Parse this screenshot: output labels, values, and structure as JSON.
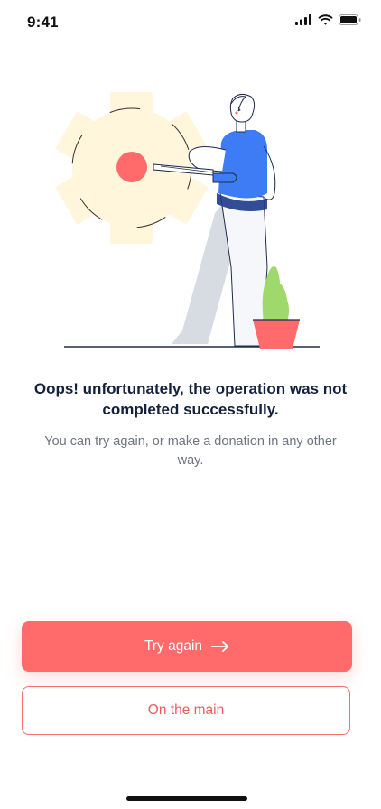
{
  "status_bar": {
    "time": "9:41"
  },
  "message": {
    "title": "Oops! unfortunately, the operation was not completed successfully.",
    "subtitle": "You can try again, or make a donation in any other way."
  },
  "actions": {
    "primary_label": "Try again",
    "secondary_label": "On the main"
  },
  "icons": {
    "status": [
      "signal-icon",
      "wifi-icon",
      "battery-icon"
    ],
    "primary_button": "arrow-right-icon"
  },
  "colors": {
    "accent": "#ff6b6b",
    "title_text": "#14213d",
    "body_text": "#6f7480",
    "gear": "#fff6dc",
    "shirt": "#3d7cf5",
    "plant": "#9fd86b"
  }
}
